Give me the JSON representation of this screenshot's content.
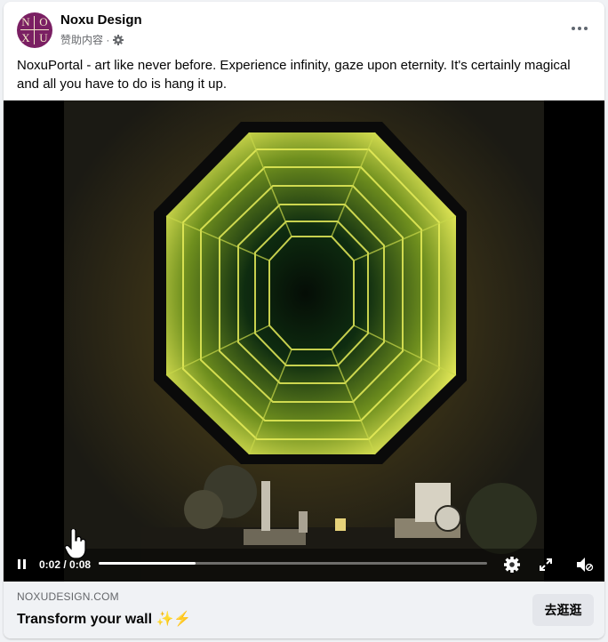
{
  "post": {
    "page_name": "Noxu Design",
    "sponsored_label": "赞助内容 ·",
    "caption": "NoxuPortal - art like never before. Experience infinity, gaze upon eternity. It's certainly magical and all you have to do is hang it up."
  },
  "avatar": {
    "letters": [
      "N",
      "O",
      "X",
      "U"
    ]
  },
  "video": {
    "time_label": "0:02 / 0:08",
    "progress": 0.25,
    "muted": true
  },
  "link": {
    "domain": "NOXUDESIGN.COM",
    "title": "Transform your wall",
    "emoji": "✨⚡",
    "cta": "去逛逛"
  },
  "colors": {
    "avatar_bg": "#7a1f63",
    "mirror_glow": "#d9e64a",
    "footer_bg": "#f0f2f5"
  }
}
